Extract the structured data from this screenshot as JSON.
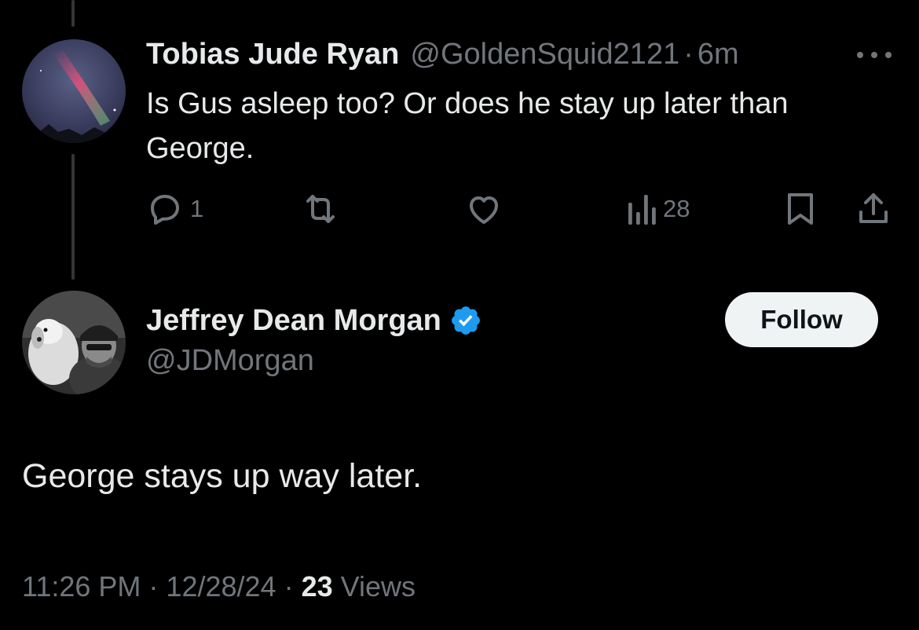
{
  "reply": {
    "author_name": "Tobias Jude Ryan",
    "handle": "@GoldenSquid2121",
    "separator": "·",
    "time": "6m",
    "text": "Is Gus asleep too? Or does he stay up later than George.",
    "actions": {
      "reply_icon": "speech-bubble-icon",
      "reply_count": "1",
      "repost_icon": "repost-icon",
      "like_icon": "heart-icon",
      "views_icon": "bar-chart-icon",
      "views_count": "28",
      "bookmark_icon": "bookmark-icon",
      "share_icon": "share-icon"
    },
    "more_icon": "more-dots-icon"
  },
  "main_tweet": {
    "author_name": "Jeffrey Dean Morgan",
    "verified_icon": "verified-badge-icon",
    "handle": "@JDMorgan",
    "follow_label": "Follow",
    "text": "George stays up way later.",
    "time": "11:26 PM",
    "separator": "·",
    "date": "12/28/24",
    "views_count": "23",
    "views_label": "Views"
  },
  "colors": {
    "background": "#000000",
    "primary_text": "#e7e9ea",
    "secondary_text": "#71767b",
    "thread_line": "#333639",
    "verified_blue": "#1d9bf0",
    "follow_bg": "#eff3f4",
    "follow_text": "#0f1419"
  }
}
